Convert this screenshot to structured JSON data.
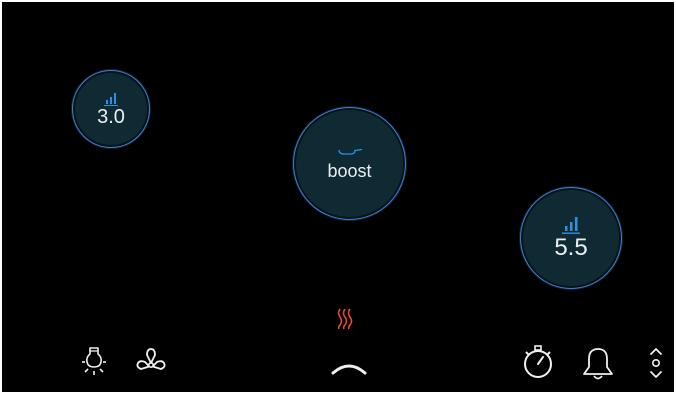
{
  "zones": [
    {
      "name": "zone-left",
      "value": "3.0",
      "icon": "power-level-icon"
    },
    {
      "name": "zone-center",
      "value": "boost",
      "icon": "pan-icon"
    },
    {
      "name": "zone-right",
      "value": "5.5",
      "icon": "power-level-icon"
    }
  ],
  "bottom_bar": {
    "left_icons": [
      "light-bulb-icon",
      "fan-icon"
    ],
    "center_icons": [
      "heat-waves-icon",
      "chevron-up-icon"
    ],
    "right_icons": [
      "timer-icon",
      "bell-icon",
      "up-down-icon"
    ]
  },
  "colors": {
    "background": "#000000",
    "zone_fill": "#0f2a33",
    "zone_ring": "#3f7fd0",
    "accent_blue": "#2f8fe0",
    "heat_red": "#e8493b",
    "icon_white": "#f0f0f0"
  }
}
